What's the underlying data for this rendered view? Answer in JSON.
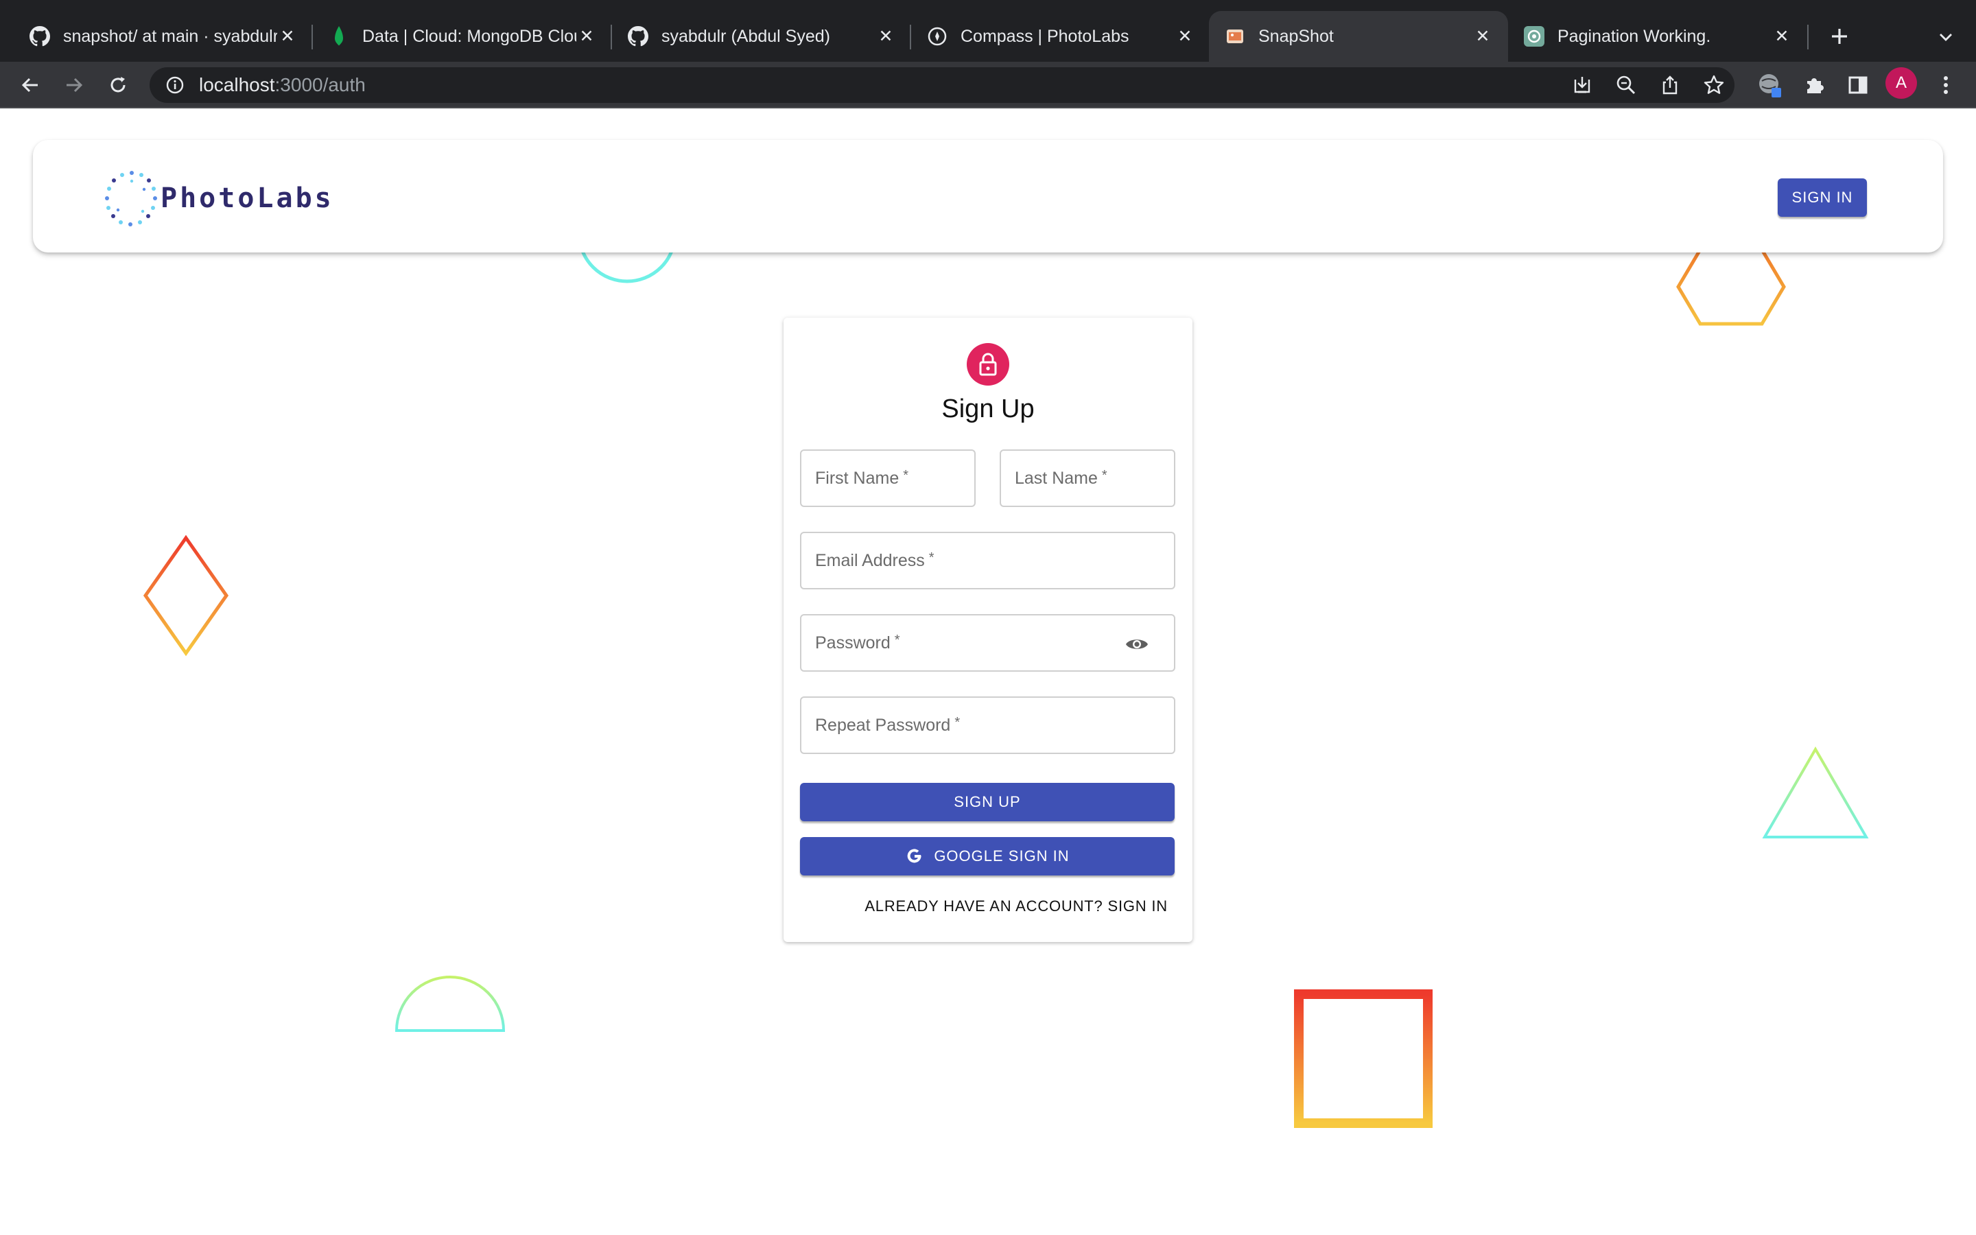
{
  "browser": {
    "tabs": [
      {
        "title": "snapshot/ at main · syabdulr/",
        "favicon": "github-icon",
        "active": false
      },
      {
        "title": "Data | Cloud: MongoDB Cloud",
        "favicon": "mongodb-leaf-icon",
        "active": false
      },
      {
        "title": "syabdulr (Abdul Syed)",
        "favicon": "github-icon",
        "active": false
      },
      {
        "title": "Compass | PhotoLabs",
        "favicon": "compass-icon",
        "active": false
      },
      {
        "title": "SnapShot",
        "favicon": "snapshot-icon",
        "active": true
      },
      {
        "title": "Pagination Working.",
        "favicon": "chatgpt-icon",
        "active": false
      }
    ],
    "url": {
      "host": "localhost",
      "path": ":3000/auth"
    },
    "profile_initial": "A"
  },
  "appbar": {
    "brand": "PhotoLabs",
    "sign_in_label": "Sign In"
  },
  "form": {
    "title": "Sign Up",
    "first_name": "First Name",
    "last_name": "Last Name",
    "email": "Email Address",
    "password": "Password",
    "repeat_password": "Repeat Password",
    "required_mark": "*",
    "submit_label": "Sign Up",
    "google_label": "Google Sign In",
    "switch_label": "Already have an account? Sign In"
  },
  "colors": {
    "primary": "#3f51b5",
    "avatar": "#e0245e",
    "brand_text": "#2f2a6b"
  }
}
